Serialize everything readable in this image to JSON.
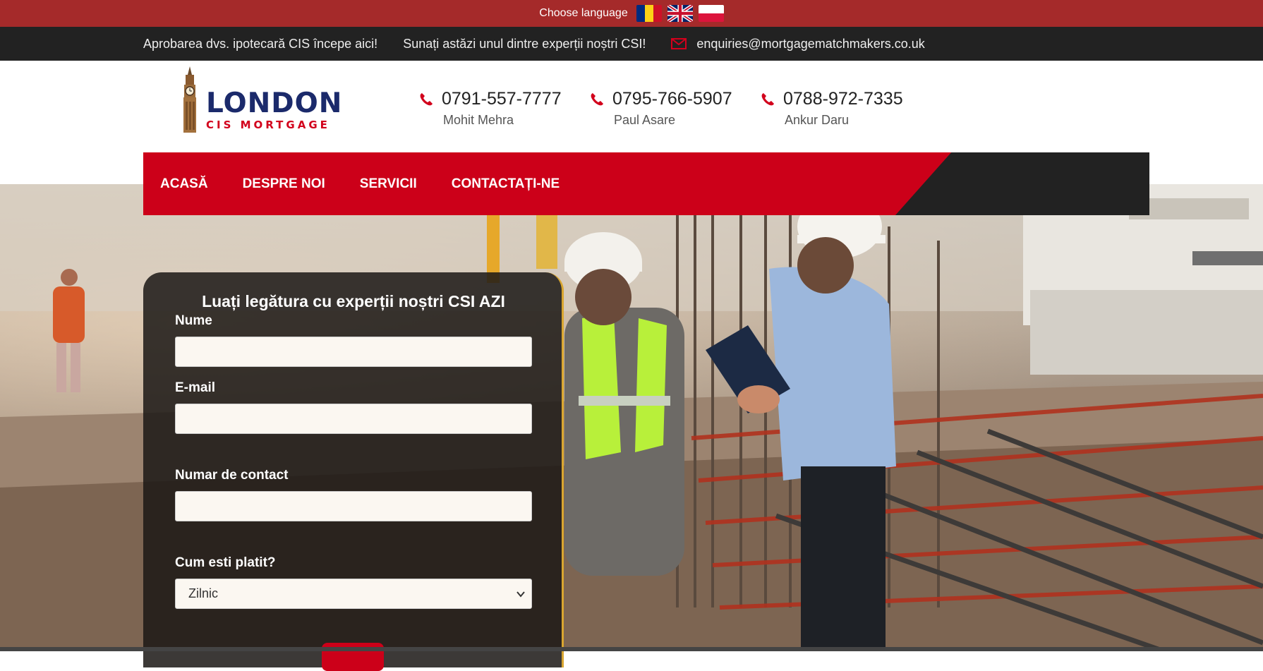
{
  "language_bar": {
    "label": "Choose language",
    "flags": [
      "romania-flag-icon",
      "uk-flag-icon",
      "poland-flag-icon"
    ]
  },
  "info_bar": {
    "tagline": "Aprobarea dvs. ipotecară CIS începe aici!",
    "call_text": "Sunați astăzi unul dintre experții noștri CSI!",
    "email": "enquiries@mortgagematchmakers.co.uk"
  },
  "logo": {
    "line1": "LONDON",
    "line2": "CIS MORTGAGE"
  },
  "contacts": [
    {
      "phone": "0791-557-7777",
      "name": "Mohit Mehra"
    },
    {
      "phone": "0795-766-5907",
      "name": "Paul Asare"
    },
    {
      "phone": "0788-972-7335",
      "name": "Ankur Daru"
    }
  ],
  "nav": {
    "items": [
      "ACASĂ",
      "DESPRE NOI",
      "SERVICII",
      "CONTACTAȚI-NE"
    ]
  },
  "form": {
    "title": "Luați legătura cu experții noștri CSI AZI",
    "name_label": "Nume",
    "email_label": "E-mail",
    "phone_label": "Numar de contact",
    "payment_label": "Cum esti platit?",
    "payment_selected": "Zilnic"
  },
  "colors": {
    "brand_red": "#cc0019",
    "lang_bar": "#a52a2a",
    "dark": "#222222",
    "logo_navy": "#1b2a6b"
  }
}
